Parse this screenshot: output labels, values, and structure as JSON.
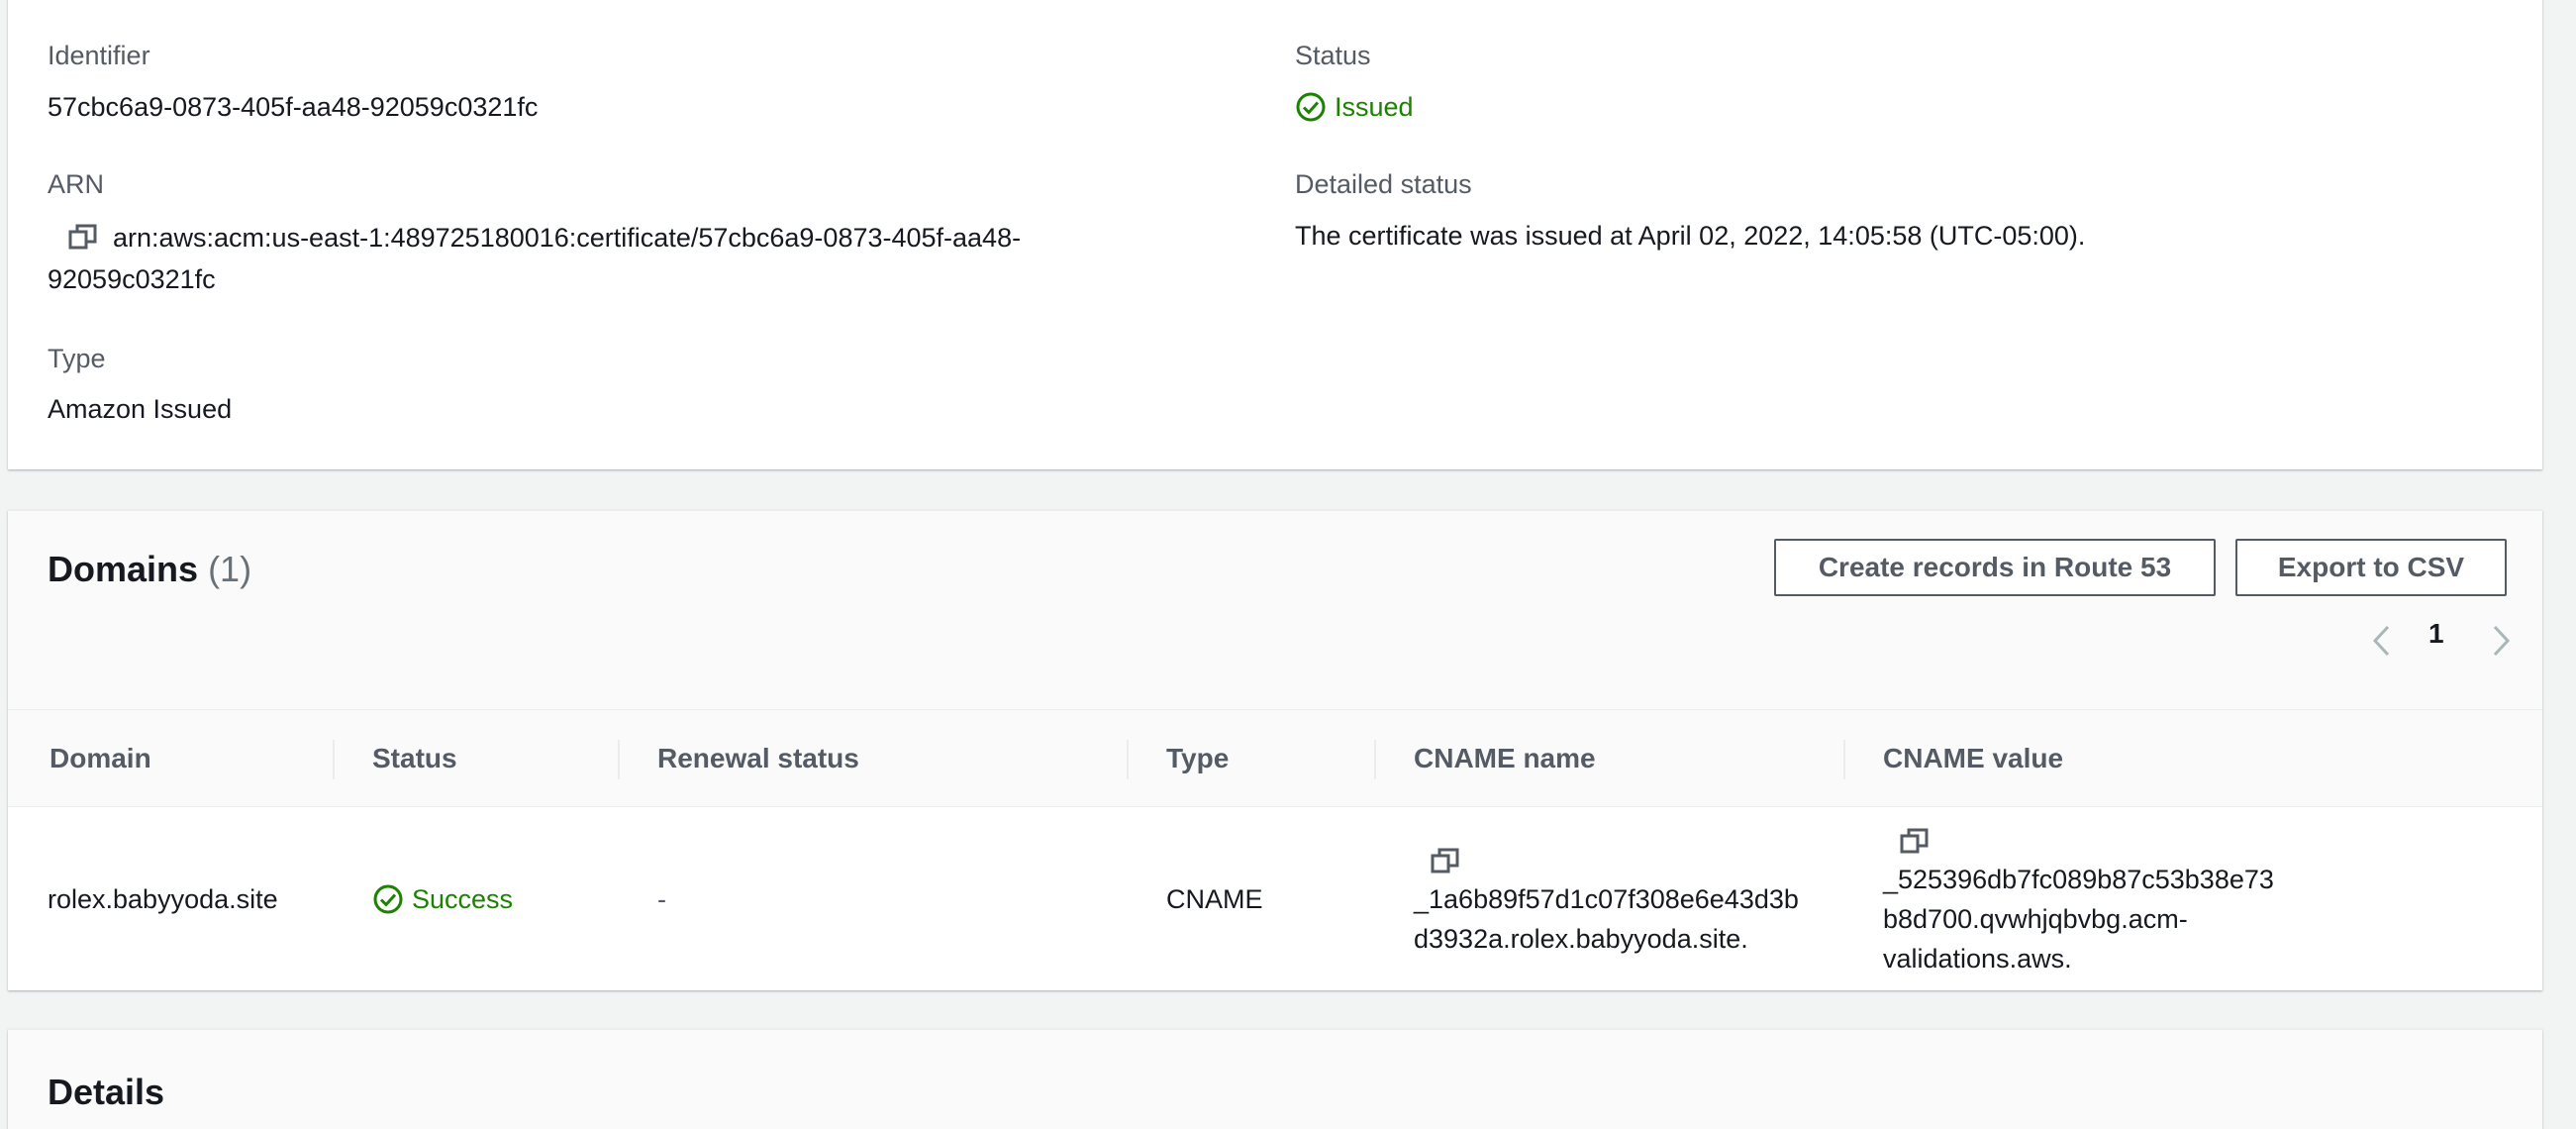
{
  "general": {
    "identifier_label": "Identifier",
    "identifier_value": "57cbc6a9-0873-405f-aa48-92059c0321fc",
    "arn_label": "ARN",
    "arn_line1": "arn:aws:acm:us-east-1:489725180016:certificate/57cbc6a9-0873-405f-aa48-",
    "arn_line2": "92059c0321fc",
    "type_label": "Type",
    "type_value": "Amazon Issued",
    "status_label": "Status",
    "status_value": "Issued",
    "detailed_status_label": "Detailed status",
    "detailed_status_value": "The certificate was issued at April 02, 2022, 14:05:58 (UTC-05:00)."
  },
  "domains": {
    "title": "Domains",
    "count": "(1)",
    "create_records_label": "Create records in Route 53",
    "export_csv_label": "Export to CSV",
    "current_page": "1",
    "columns": [
      "Domain",
      "Status",
      "Renewal status",
      "Type",
      "CNAME name",
      "CNAME value"
    ],
    "rows": [
      {
        "domain": "rolex.babyyoda.site",
        "status": "Success",
        "renewal_status": "-",
        "type": "CNAME",
        "cname_name_line1": "_1a6b89f57d1c07f308e6e43d3b",
        "cname_name_line2": "d3932a.rolex.babyyoda.site.",
        "cname_value_line1": "_525396db7fc089b87c53b38e73",
        "cname_value_line2": "b8d700.qvwhjqbvbg.acm-",
        "cname_value_line3": "validations.aws."
      }
    ]
  },
  "details": {
    "title": "Details"
  },
  "colors": {
    "success": "#1d8102",
    "secondary_text": "#545b64",
    "page_bg": "#f2f3f3"
  },
  "icons": [
    "copy-icon",
    "check-circle-icon",
    "chevron-left-icon",
    "chevron-right-icon"
  ]
}
